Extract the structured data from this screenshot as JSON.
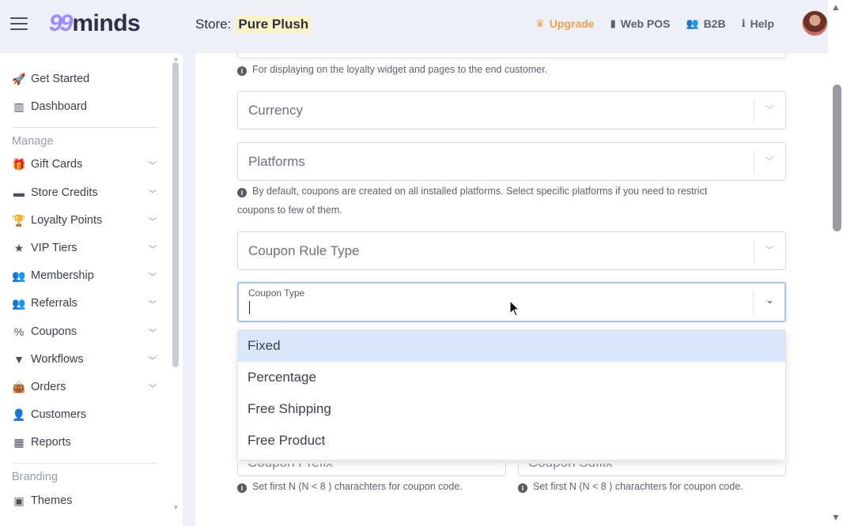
{
  "header": {
    "logo_mark": "99",
    "logo_text": "minds",
    "store_label": "Store:",
    "store_name": "Pure Plush",
    "actions": [
      {
        "label": "Upgrade",
        "icon": "crown-icon"
      },
      {
        "label": "Web POS",
        "icon": "mouse-icon"
      },
      {
        "label": "B2B",
        "icon": "users-icon"
      },
      {
        "label": "Help",
        "icon": "info-icon"
      }
    ]
  },
  "sidebar": {
    "top_items": [
      {
        "label": "Get Started",
        "icon": "rocket-icon"
      },
      {
        "label": "Dashboard",
        "icon": "chart-icon"
      }
    ],
    "manage_label": "Manage",
    "manage_items": [
      {
        "label": "Gift Cards",
        "icon": "gift-icon"
      },
      {
        "label": "Store Credits",
        "icon": "wallet-icon"
      },
      {
        "label": "Loyalty Points",
        "icon": "trophy-icon"
      },
      {
        "label": "VIP Tiers",
        "icon": "star-icon"
      },
      {
        "label": "Membership",
        "icon": "users-icon"
      },
      {
        "label": "Referrals",
        "icon": "user-group-icon"
      },
      {
        "label": "Coupons",
        "icon": "percent-icon"
      },
      {
        "label": "Workflows",
        "icon": "filter-icon"
      },
      {
        "label": "Orders",
        "icon": "bag-icon"
      },
      {
        "label": "Customers",
        "icon": "user-icon"
      },
      {
        "label": "Reports",
        "icon": "table-icon"
      }
    ],
    "branding_label": "Branding",
    "branding_items": [
      {
        "label": "Themes",
        "icon": "image-icon"
      }
    ]
  },
  "form": {
    "name_hint": "For displaying on the loyalty widget and pages to the end customer.",
    "currency_label": "Currency",
    "platforms_label": "Platforms",
    "platforms_hint_1": "By default, coupons are created on all installed platforms. Select specific platforms if you need to restrict",
    "platforms_hint_2": "coupons to few of them.",
    "coupon_rule_type_label": "Coupon Rule Type",
    "coupon_type_label": "Coupon Type",
    "coupon_type_value": "",
    "coupon_type_options": [
      "Fixed",
      "Percentage",
      "Free Shipping",
      "Free Product"
    ],
    "coupon_prefix_label": "Coupon Prefix",
    "coupon_suffix_label": "Coupon Suffix",
    "prefix_hint": "Set first N (N < 8 ) charachters for coupon code.",
    "suffix_hint": "Set first N (N < 8 ) charachters for coupon code."
  }
}
